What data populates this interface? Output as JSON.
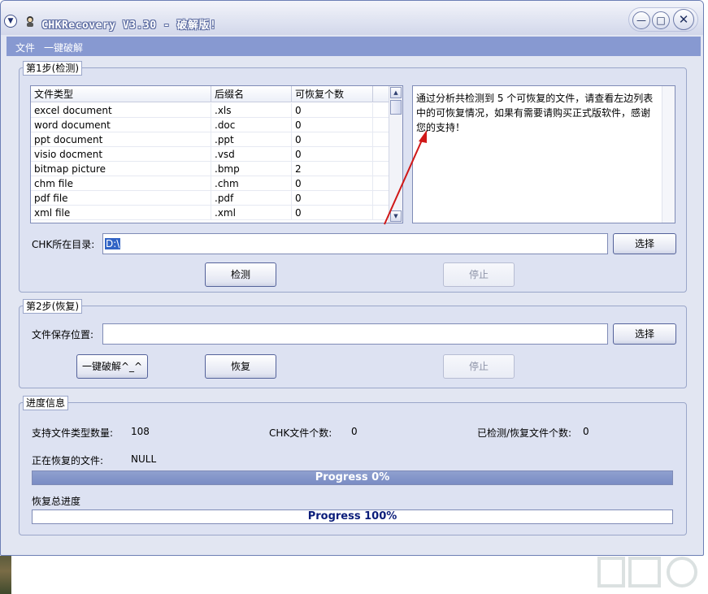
{
  "window": {
    "title": "CHKRecovery V3.30 - 破解版!",
    "minimize_icon": "minimize-icon",
    "maximize_icon": "maximize-icon",
    "close_icon": "close-icon"
  },
  "menu": [
    "文件",
    "一键破解"
  ],
  "step1": {
    "label": "第1步(检测)",
    "table": {
      "columns": [
        "文件类型",
        "后缀名",
        "可恢复个数"
      ],
      "rows": [
        [
          "excel document",
          ".xls",
          "0"
        ],
        [
          "word document",
          ".doc",
          "0"
        ],
        [
          "ppt document",
          ".ppt",
          "0"
        ],
        [
          "visio docment",
          ".vsd",
          "0"
        ],
        [
          "bitmap picture",
          ".bmp",
          "2"
        ],
        [
          "chm file",
          ".chm",
          "0"
        ],
        [
          "pdf file",
          ".pdf",
          "0"
        ],
        [
          "xml file",
          ".xml",
          "0"
        ]
      ]
    },
    "message": "通过分析共检测到 5 个可恢复的文件，请查看左边列表中的可恢复情况，如果有需要请购买正式版软件，感谢您的支持！",
    "dir_label": "CHK所在目录:",
    "dir_value": "D:\\",
    "select_label": "选择",
    "detect_label": "检测",
    "stop_label": "停止"
  },
  "step2": {
    "label": "第2步(恢复)",
    "save_label": "文件保存位置:",
    "save_value": "",
    "select_label": "选择",
    "crack_label": "一键破解^_^",
    "recover_label": "恢复",
    "stop_label": "停止"
  },
  "progress": {
    "label": "进度信息",
    "types_label": "支持文件类型数量:",
    "types_value": "108",
    "chk_label": "CHK文件个数:",
    "chk_value": "0",
    "done_label": "已检测/恢复文件个数:",
    "done_value": "0",
    "current_label": "正在恢复的文件:",
    "current_value": "NULL",
    "bar1_text": "Progress 0%",
    "bar1_fraction": 0,
    "total_label": "恢复总进度",
    "bar2_text": "Progress 100%",
    "bar2_fraction": 1
  },
  "colors": {
    "menubar": "#8799d1",
    "progress_text": "#0b1d7a",
    "arrow": "#d01818"
  }
}
